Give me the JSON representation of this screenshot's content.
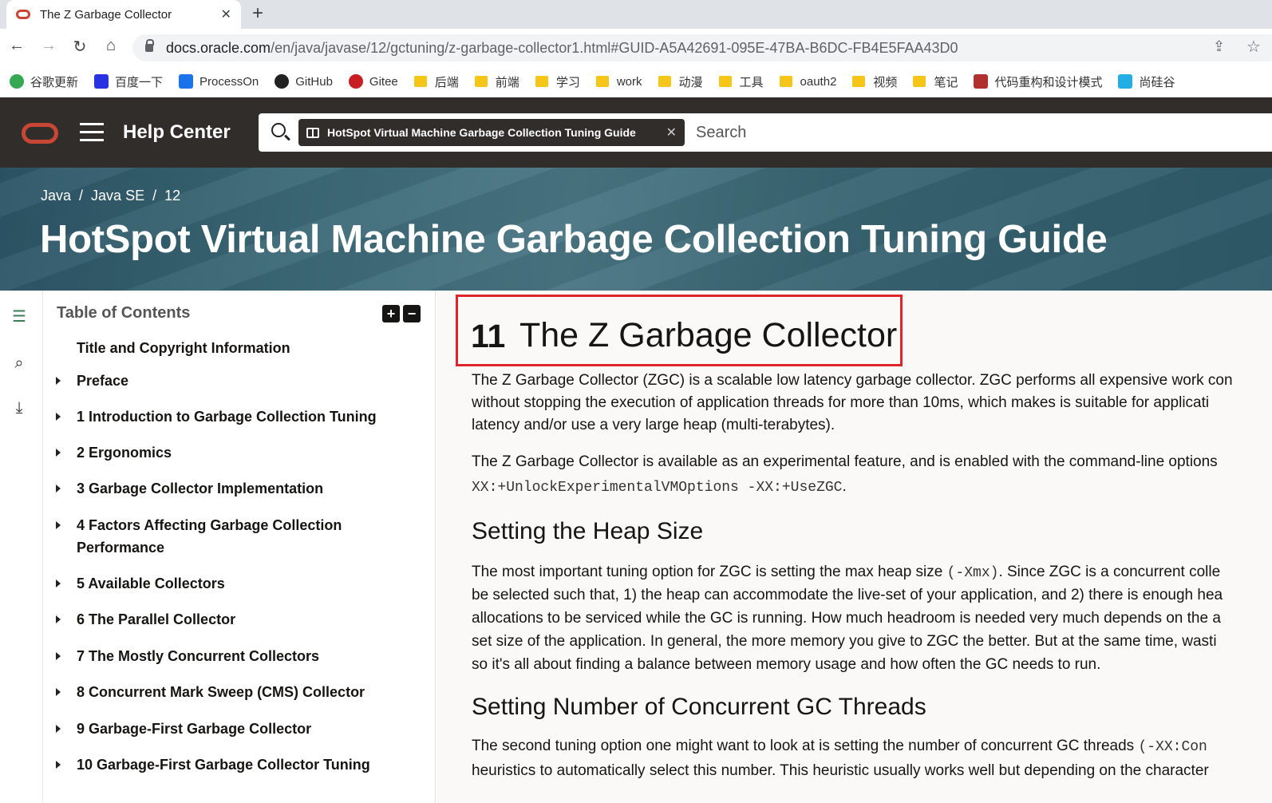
{
  "browser": {
    "tab_title": "The Z Garbage Collector",
    "tab_close": "✕",
    "new_tab": "+",
    "url_host": "docs.oracle.com",
    "url_path": "/en/java/javase/12/gctuning/z-garbage-collector1.html#GUID-A5A42691-095E-47BA-B6DC-FB4E5FAA43D0"
  },
  "bookmarks": [
    {
      "label": "谷歌更新",
      "icon": "chrome-icon"
    },
    {
      "label": "百度一下",
      "icon": "baidu-icon"
    },
    {
      "label": "ProcessOn",
      "icon": "processon-icon"
    },
    {
      "label": "GitHub",
      "icon": "github-icon"
    },
    {
      "label": "Gitee",
      "icon": "gitee-icon"
    },
    {
      "label": "后端",
      "icon": "folder-icon"
    },
    {
      "label": "前端",
      "icon": "folder-icon"
    },
    {
      "label": "学习",
      "icon": "folder-icon"
    },
    {
      "label": "work",
      "icon": "folder-icon"
    },
    {
      "label": "动漫",
      "icon": "folder-icon"
    },
    {
      "label": "工具",
      "icon": "folder-icon"
    },
    {
      "label": "oauth2",
      "icon": "folder-icon"
    },
    {
      "label": "视频",
      "icon": "folder-icon"
    },
    {
      "label": "笔记",
      "icon": "folder-icon"
    },
    {
      "label": "代码重构和设计模式",
      "icon": "site-icon"
    },
    {
      "label": "尚硅谷",
      "icon": "bilibili-icon"
    }
  ],
  "header": {
    "help_center": "Help Center",
    "search_chip": "HotSpot Virtual Machine Garbage Collection Tuning Guide",
    "search_placeholder": "Search"
  },
  "banner": {
    "crumbs": [
      "Java",
      "Java SE",
      "12"
    ],
    "crumb_sep": "/",
    "title": "HotSpot Virtual Machine Garbage Collection Tuning Guide"
  },
  "toc": {
    "heading": "Table of Contents",
    "expand": "+",
    "collapse": "−",
    "items": [
      {
        "label": "Title and Copyright Information",
        "has_children": false
      },
      {
        "label": "Preface",
        "has_children": true
      },
      {
        "label": "1 Introduction to Garbage Collection Tuning",
        "has_children": true
      },
      {
        "label": "2 Ergonomics",
        "has_children": true
      },
      {
        "label": "3 Garbage Collector Implementation",
        "has_children": true
      },
      {
        "label": "4 Factors Affecting Garbage Collection Performance",
        "has_children": true
      },
      {
        "label": "5 Available Collectors",
        "has_children": true
      },
      {
        "label": "6 The Parallel Collector",
        "has_children": true
      },
      {
        "label": "7 The Mostly Concurrent Collectors",
        "has_children": true
      },
      {
        "label": "8 Concurrent Mark Sweep (CMS) Collector",
        "has_children": true
      },
      {
        "label": "9 Garbage-First Garbage Collector",
        "has_children": true
      },
      {
        "label": "10 Garbage-First Garbage Collector Tuning",
        "has_children": true
      }
    ]
  },
  "article": {
    "chapter_num": "11",
    "chapter_title": "The Z Garbage Collector",
    "p1": [
      "The Z Garbage Collector (ZGC) is a scalable low latency garbage collector. ZGC performs all expensive work con",
      "without stopping the execution of application threads for more than 10ms, which makes is suitable for applicati",
      "latency and/or use a very large heap (multi-terabytes)."
    ],
    "p2_line1": "The Z Garbage Collector is available as an experimental feature, and is enabled with the command-line options",
    "p2_code": "XX:+UnlockExperimentalVMOptions -XX:+UseZGC",
    "p2_end": ".",
    "h2_heap": "Setting the Heap Size",
    "p3_pre": "The most important tuning option for ZGC is setting the max heap size ",
    "p3_code": "(-Xmx)",
    "p3_post": ". Since ZGC is a concurrent colle",
    "p3": [
      "be selected such that, 1) the heap can accommodate the live-set of your application, and 2) there is enough hea",
      "allocations to be serviced while the GC is running. How much headroom is needed very much depends on the a",
      "set size of the application. In general, the more memory you give to ZGC the better. But at the same time, wasti",
      "so it's all about finding a balance between memory usage and how often the GC needs to run."
    ],
    "h2_threads": "Setting Number of Concurrent GC Threads",
    "p4_pre": "The second tuning option one might want to look at is setting the number of concurrent GC threads ",
    "p4_code": "(-XX:Con",
    "p4_line2": "heuristics to automatically select this number. This heuristic usually works well but depending on the character"
  }
}
